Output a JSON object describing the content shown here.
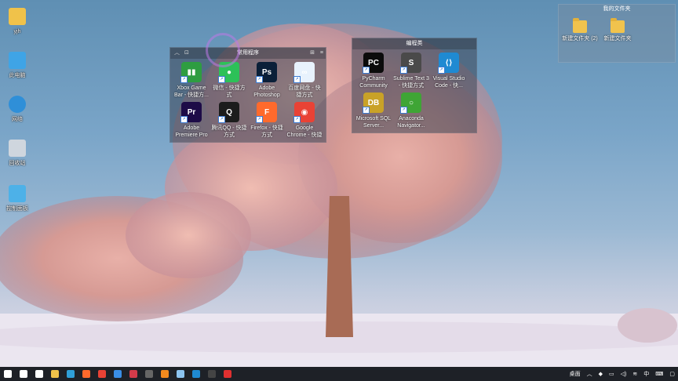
{
  "desktop_icons": [
    {
      "label": "yjh",
      "icon": "user-folder-icon",
      "color": "#f0c24a"
    },
    {
      "label": "此电脑",
      "icon": "computer-icon",
      "color": "#3fa4e6"
    },
    {
      "label": "网络",
      "icon": "network-icon",
      "color": "#2f8fd8"
    },
    {
      "label": "回收站",
      "icon": "recycle-bin-icon",
      "color": "#cfd6de"
    },
    {
      "label": "控制面板",
      "icon": "control-panel-icon",
      "color": "#4db1e8"
    }
  ],
  "fence_common": {
    "title": "常用程序",
    "apps": [
      {
        "label": "Xbox Game Bar - 快捷方...",
        "icon": "xbox-game-bar-icon",
        "color": "#2e9d41",
        "glyph": "▮▮"
      },
      {
        "label": "微信 - 快捷方式",
        "icon": "wechat-icon",
        "color": "#2dc158",
        "glyph": "●"
      },
      {
        "label": "Adobe Photoshop 202...",
        "icon": "photoshop-icon",
        "color": "#0a1f38",
        "glyph": "Ps"
      },
      {
        "label": "百度网盘 - 快捷方式",
        "icon": "baidu-netdisk-icon",
        "color": "#e8f2fd",
        "glyph": "∞"
      },
      {
        "label": "Adobe Premiere Pro 20...",
        "icon": "premiere-icon",
        "color": "#1d0b47",
        "glyph": "Pr"
      },
      {
        "label": "腾讯QQ - 快捷方式",
        "icon": "qq-icon",
        "color": "#1c1c1c",
        "glyph": "Q"
      },
      {
        "label": "Firefox - 快捷方式",
        "icon": "firefox-icon",
        "color": "#ff6a2c",
        "glyph": "F"
      },
      {
        "label": "Google Chrome - 快捷方...",
        "icon": "chrome-icon",
        "color": "#e94235",
        "glyph": "◉"
      }
    ]
  },
  "fence_dev": {
    "title": "编程类",
    "apps": [
      {
        "label": "PyCharm Community E...",
        "icon": "pycharm-icon",
        "color": "#0b0b0b",
        "glyph": "PC"
      },
      {
        "label": "Sublime Text 3 - 快捷方式",
        "icon": "sublime-icon",
        "color": "#4a4a4a",
        "glyph": "S"
      },
      {
        "label": "Visual Studio Code - 快...",
        "icon": "vscode-icon",
        "color": "#1f8ad2",
        "glyph": "⟨⟩"
      },
      {
        "label": "Microsoft SQL Server...",
        "icon": "sql-server-icon",
        "color": "#c9a227",
        "glyph": "DB"
      },
      {
        "label": "Anaconda Navigator...",
        "icon": "anaconda-icon",
        "color": "#3fa535",
        "glyph": "○"
      }
    ]
  },
  "docs_box": {
    "title": "我的文件夹",
    "folders": [
      {
        "label": "新建文件夹 (2)",
        "icon": "folder-icon"
      },
      {
        "label": "新建文件夹",
        "icon": "folder-icon"
      }
    ]
  },
  "taskbar": {
    "buttons": [
      {
        "name": "start-icon",
        "color": "#ffffff"
      },
      {
        "name": "search-icon",
        "color": "#ffffff"
      },
      {
        "name": "task-view-icon",
        "color": "#ffffff"
      },
      {
        "name": "file-explorer-icon",
        "color": "#f0c24a"
      },
      {
        "name": "edge-icon",
        "color": "#2f9fd8"
      },
      {
        "name": "firefox-icon",
        "color": "#ff6a2c"
      },
      {
        "name": "chrome-icon",
        "color": "#e94235"
      },
      {
        "name": "mail-icon",
        "color": "#3a8ee6"
      },
      {
        "name": "app-icon",
        "color": "#d33b4a"
      },
      {
        "name": "terminal-icon",
        "color": "#666666"
      },
      {
        "name": "sublime-icon",
        "color": "#f28a1e"
      },
      {
        "name": "pen-icon",
        "color": "#8cc4f0"
      },
      {
        "name": "vscode-icon",
        "color": "#1f8ad2"
      },
      {
        "name": "terminal-dark-icon",
        "color": "#444444"
      },
      {
        "name": "record-icon",
        "color": "#e03030"
      }
    ],
    "tray_desktop_label": "桌面",
    "tray_ime": "中"
  }
}
